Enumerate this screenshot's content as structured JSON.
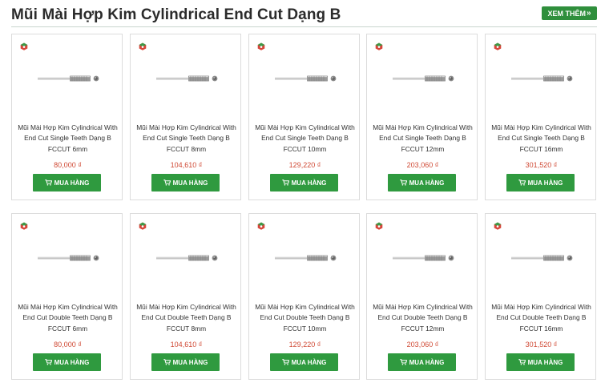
{
  "header": {
    "title": "Mũi Mài Hợp Kim Cylindrical End Cut Dạng B",
    "more_label": "XEM THÊM",
    "more_icon": "double-chevron-right-icon"
  },
  "colors": {
    "accent_green": "#2f9a3f",
    "price_red": "#d04a35",
    "border": "#dcdcdc"
  },
  "products": [
    {
      "name": "Mũi Mài Hợp Kim Cylindrical With End Cut Single Teeth Dạng B FCCUT 6mm",
      "price": "80,000 ₫",
      "button": "MUA HÀNG"
    },
    {
      "name": "Mũi Mài Hợp Kim Cylindrical With End Cut Single Teeth Dạng B FCCUT 8mm",
      "price": "104,610 ₫",
      "button": "MUA HÀNG"
    },
    {
      "name": "Mũi Mài Hợp Kim Cylindrical With End Cut Single Teeth Dạng B FCCUT 10mm",
      "price": "129,220 ₫",
      "button": "MUA HÀNG"
    },
    {
      "name": "Mũi Mài Hợp Kim Cylindrical With End Cut Single Teeth Dạng B FCCUT 12mm",
      "price": "203,060 ₫",
      "button": "MUA HÀNG"
    },
    {
      "name": "Mũi Mài Hợp Kim Cylindrical With End Cut Single Teeth Dạng B FCCUT 16mm",
      "price": "301,520 ₫",
      "button": "MUA HÀNG"
    },
    {
      "name": "Mũi Mài Hợp Kim Cylindrical With End Cut Double Teeth Dạng B FCCUT 6mm",
      "price": "80,000 ₫",
      "button": "MUA HÀNG"
    },
    {
      "name": "Mũi Mài Hợp Kim Cylindrical With End Cut Double Teeth Dạng B FCCUT 8mm",
      "price": "104,610 ₫",
      "button": "MUA HÀNG"
    },
    {
      "name": "Mũi Mài Hợp Kim Cylindrical With End Cut Double Teeth Dạng B FCCUT 10mm",
      "price": "129,220 ₫",
      "button": "MUA HÀNG"
    },
    {
      "name": "Mũi Mài Hợp Kim Cylindrical With End Cut Double Teeth Dạng B FCCUT 12mm",
      "price": "203,060 ₫",
      "button": "MUA HÀNG"
    },
    {
      "name": "Mũi Mài Hợp Kim Cylindrical With End Cut Double Teeth Dạng B FCCUT 16mm",
      "price": "301,520 ₫",
      "button": "MUA HÀNG"
    }
  ]
}
